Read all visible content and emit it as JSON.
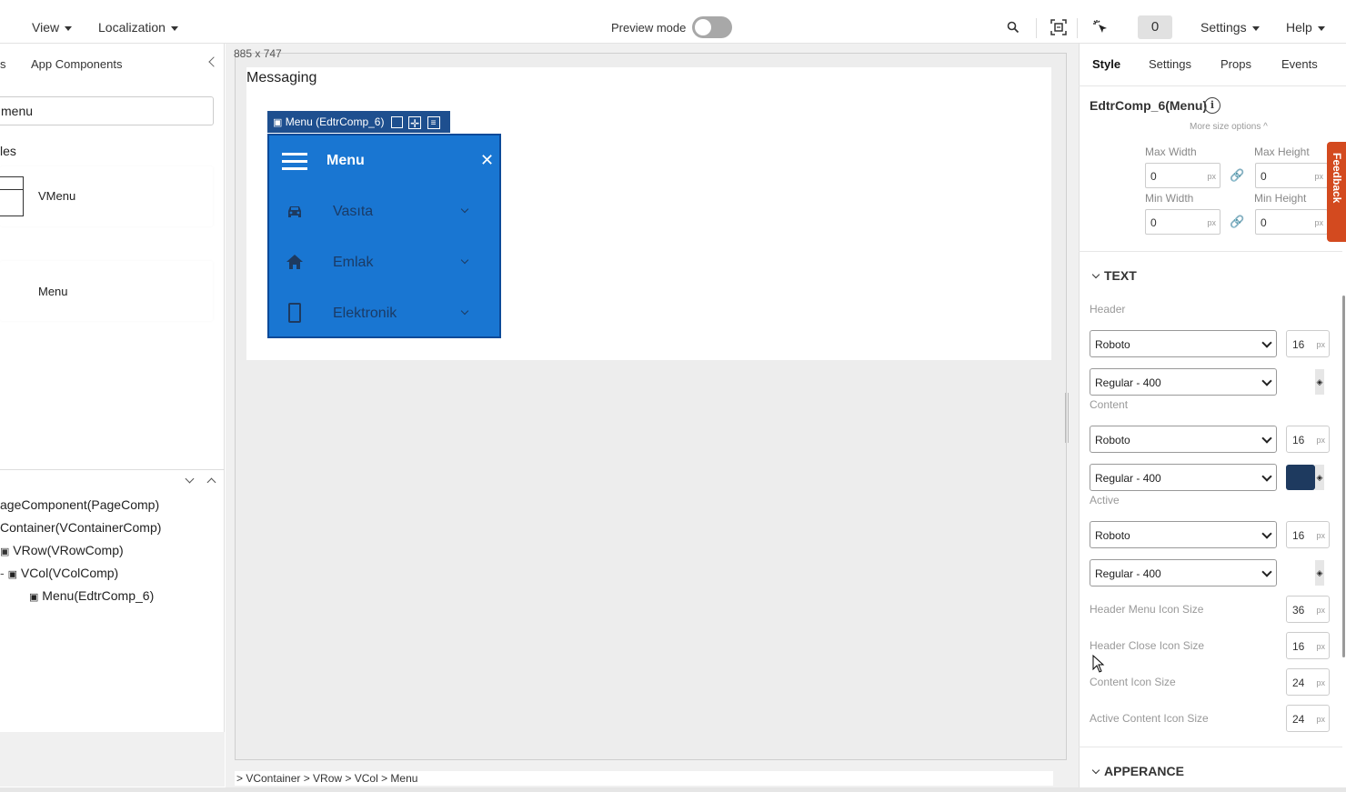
{
  "topbar": {
    "view": "View",
    "localization": "Localization",
    "preview_mode": "Preview mode",
    "count": "0",
    "settings": "Settings",
    "help": "Help"
  },
  "left_panel": {
    "tab_partial": "s",
    "tab_app_components": "App Components",
    "search_value": "menu",
    "section_partial": "les",
    "card1_label": "VMenu",
    "card2_label": "Menu",
    "tree": [
      "ageComponent(PageComp)",
      "Container(VContainerComp)",
      "VRow(VRowComp)",
      "VCol(VColComp)",
      "Menu(EdtrComp_6)"
    ]
  },
  "canvas": {
    "size": "885 x 747",
    "page_title": "Messaging",
    "selection_tag": "Menu (EdtrComp_6)",
    "menu": {
      "title": "Menu",
      "items": [
        "Vasıta",
        "Emlak",
        "Elektronik"
      ]
    },
    "breadcrumb": "> VContainer > VRow > VCol > Menu"
  },
  "right_panel": {
    "tabs": [
      "Style",
      "Settings",
      "Props",
      "Events"
    ],
    "component_title": "EdtrComp_6(Menu)",
    "more_size_options": "More size options ^",
    "max_width_label": "Max Width",
    "max_height_label": "Max Height",
    "min_width_label": "Min Width",
    "min_height_label": "Min Height",
    "max_width": "0",
    "max_height": "0",
    "min_width": "0",
    "min_height": "0",
    "unit": "px",
    "text_section": "TEXT",
    "header_label": "Header",
    "content_label": "Content",
    "active_label": "Active",
    "font_family": "Roboto",
    "font_weight": "Regular - 400",
    "font_size": "16",
    "header_menu_icon_size_label": "Header Menu Icon Size",
    "header_menu_icon_size": "36",
    "header_close_icon_size_label": "Header Close Icon Size",
    "header_close_icon_size": "16",
    "content_icon_size_label": "Content Icon Size",
    "content_icon_size": "24",
    "active_content_icon_size_label": "Active Content Icon Size",
    "active_content_icon_size": "24",
    "appearance_section": "APPERANCE",
    "content_color": "#1e3a5f",
    "feedback": "Feedback"
  }
}
